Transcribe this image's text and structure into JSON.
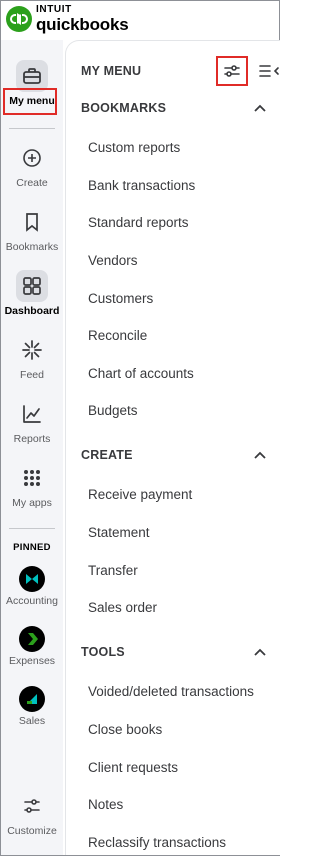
{
  "brand": {
    "line1": "INTUIT",
    "line2": "quickbooks",
    "accent": "#2ca01c"
  },
  "rail": {
    "items": [
      {
        "label": "My menu"
      },
      {
        "label": "Create"
      },
      {
        "label": "Bookmarks"
      },
      {
        "label": "Dashboard"
      },
      {
        "label": "Feed"
      },
      {
        "label": "Reports"
      },
      {
        "label": "My apps"
      }
    ],
    "pinned_label": "PINNED",
    "pinned": [
      {
        "label": "Accounting",
        "color": "#00c1bf"
      },
      {
        "label": "Expenses",
        "color": "#2ca01c"
      },
      {
        "label": "Sales",
        "color": "#00c1bf"
      }
    ],
    "customize_label": "Customize"
  },
  "panel": {
    "title": "MY MENU",
    "sections": {
      "bookmarks": {
        "title": "BOOKMARKS",
        "items": [
          "Custom reports",
          "Bank transactions",
          "Standard reports",
          "Vendors",
          "Customers",
          "Reconcile",
          "Chart of accounts",
          "Budgets"
        ]
      },
      "create": {
        "title": "CREATE",
        "items": [
          "Receive payment",
          "Statement",
          "Transfer",
          "Sales order"
        ]
      },
      "tools": {
        "title": "TOOLS",
        "items": [
          "Voided/deleted transactions",
          "Close books",
          "Client requests",
          "Notes",
          "Reclassify transactions"
        ]
      }
    }
  },
  "highlight_color": "#e02b27"
}
